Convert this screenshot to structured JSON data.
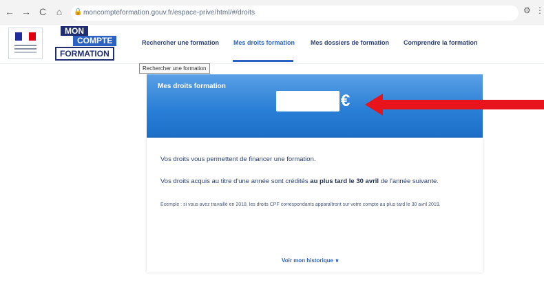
{
  "browser": {
    "back_icon": "←",
    "forward_icon": "→",
    "reload_icon": "C",
    "home_icon": "⌂",
    "url": "moncompteformation.gouv.fr/espace-prive/html/#/droits",
    "lock_icon": "🔒"
  },
  "header": {
    "logo_mon": "MON",
    "logo_compte": "COMPTE",
    "logo_formation": "FORMATION",
    "nav": [
      {
        "label": "Rechercher une formation"
      },
      {
        "label": "Mes droits formation"
      },
      {
        "label": "Mes dossiers de formation"
      },
      {
        "label": "Comprendre la formation"
      }
    ],
    "tooltip": "Rechercher une formation"
  },
  "rights": {
    "title": "Mes droits formation",
    "currency": "€"
  },
  "info": {
    "line1": "Vos droits vous permettent de financer une formation.",
    "line2_prefix": "Vos droits acquis au titre d'une année sont crédités ",
    "line2_bold": "au plus tard le 30 avril",
    "line2_suffix": " de l'année suivante.",
    "example": "Exemple : si vous avez travaillé en 2018, les droits CPF correspondants apparaîtront sur votre compte au plus tard le 30 avril 2019.",
    "history_link": "Voir mon historique",
    "chevron": "∨"
  },
  "colors": {
    "brand_dark": "#1f2d6e",
    "brand_blue": "#2b62c2",
    "annotation_red": "#e8141b"
  }
}
